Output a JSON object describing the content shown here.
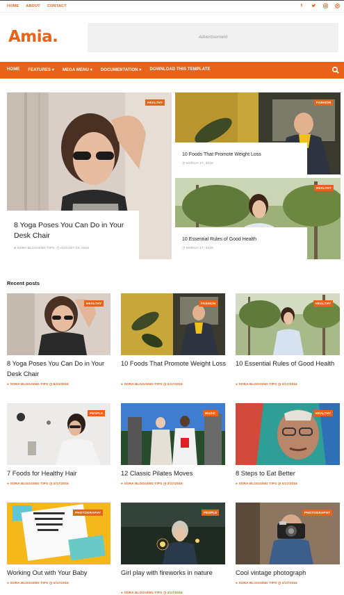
{
  "topbar": {
    "links": [
      "HOME",
      "ABOUT",
      "CONTACT"
    ],
    "social": [
      "f",
      "t",
      "ig",
      "p"
    ]
  },
  "logo": "Amia.",
  "ad": {
    "label": "Advertisement"
  },
  "nav": {
    "items": [
      "HOME",
      "FEATURES ▾",
      "MEGA MENU ▾",
      "DOCUMENTATION ▾",
      "DOWNLOAD THIS TEMPLATE"
    ],
    "accent": "#e8621a"
  },
  "featured": {
    "main": {
      "badge": "HEALTHY",
      "title": "8 Yoga Poses You Can Do in Your Desk Chair",
      "author": "SORA BLOGGING TIPS",
      "date": "AUGUST 23, 2016"
    },
    "side": [
      {
        "badge": "FASHION",
        "title": "10 Foods That Promote Weight Loss",
        "date": "MARCH 17, 2016"
      },
      {
        "badge": "HEALTHY",
        "title": "10 Essential Rules of Good Health",
        "date": "MARCH 17, 2016"
      }
    ]
  },
  "recent": {
    "heading": "Recent posts",
    "posts": [
      {
        "badge": "HEALTHY",
        "title": "8 Yoga Poses You Can Do in Your Desk Chair",
        "author": "SORA BLOGGING TIPS",
        "date": "8/23/2016"
      },
      {
        "badge": "FASHION",
        "title": "10 Foods That Promote Weight Loss",
        "author": "SORA BLOGGING TIPS",
        "date": "3/17/2016"
      },
      {
        "badge": "HEALTHY",
        "title": "10 Essential Rules of Good Health",
        "author": "SORA BLOGGING TIPS",
        "date": "3/17/2016"
      },
      {
        "badge": "PEOPLE",
        "title": "7 Foods for Healthy Hair",
        "author": "SORA BLOGGING TIPS",
        "date": "3/17/2016"
      },
      {
        "badge": "MUSIC",
        "title": "12 Classic Pilates Moves",
        "author": "SORA BLOGGING TIPS",
        "date": "3/17/2016"
      },
      {
        "badge": "HEALTHY",
        "title": "8 Steps to Eat Better",
        "author": "SORA BLOGGING TIPS",
        "date": "3/17/2016"
      },
      {
        "badge": "PHOTOGRAPHY",
        "title": "Working Out with Your Baby",
        "author": "SORA BLOGGING TIPS",
        "date": "3/17/2016"
      },
      {
        "badge": "PEOPLE",
        "title": "Girl play with fireworks in nature",
        "author": "SORA BLOGGING TIPS",
        "date": "3/17/2016"
      },
      {
        "badge": "PHOTOGRAPHY",
        "title": "Cool vintage photograph",
        "author": "SORA BLOGGING TIPS",
        "date": "3/17/2016"
      }
    ]
  }
}
